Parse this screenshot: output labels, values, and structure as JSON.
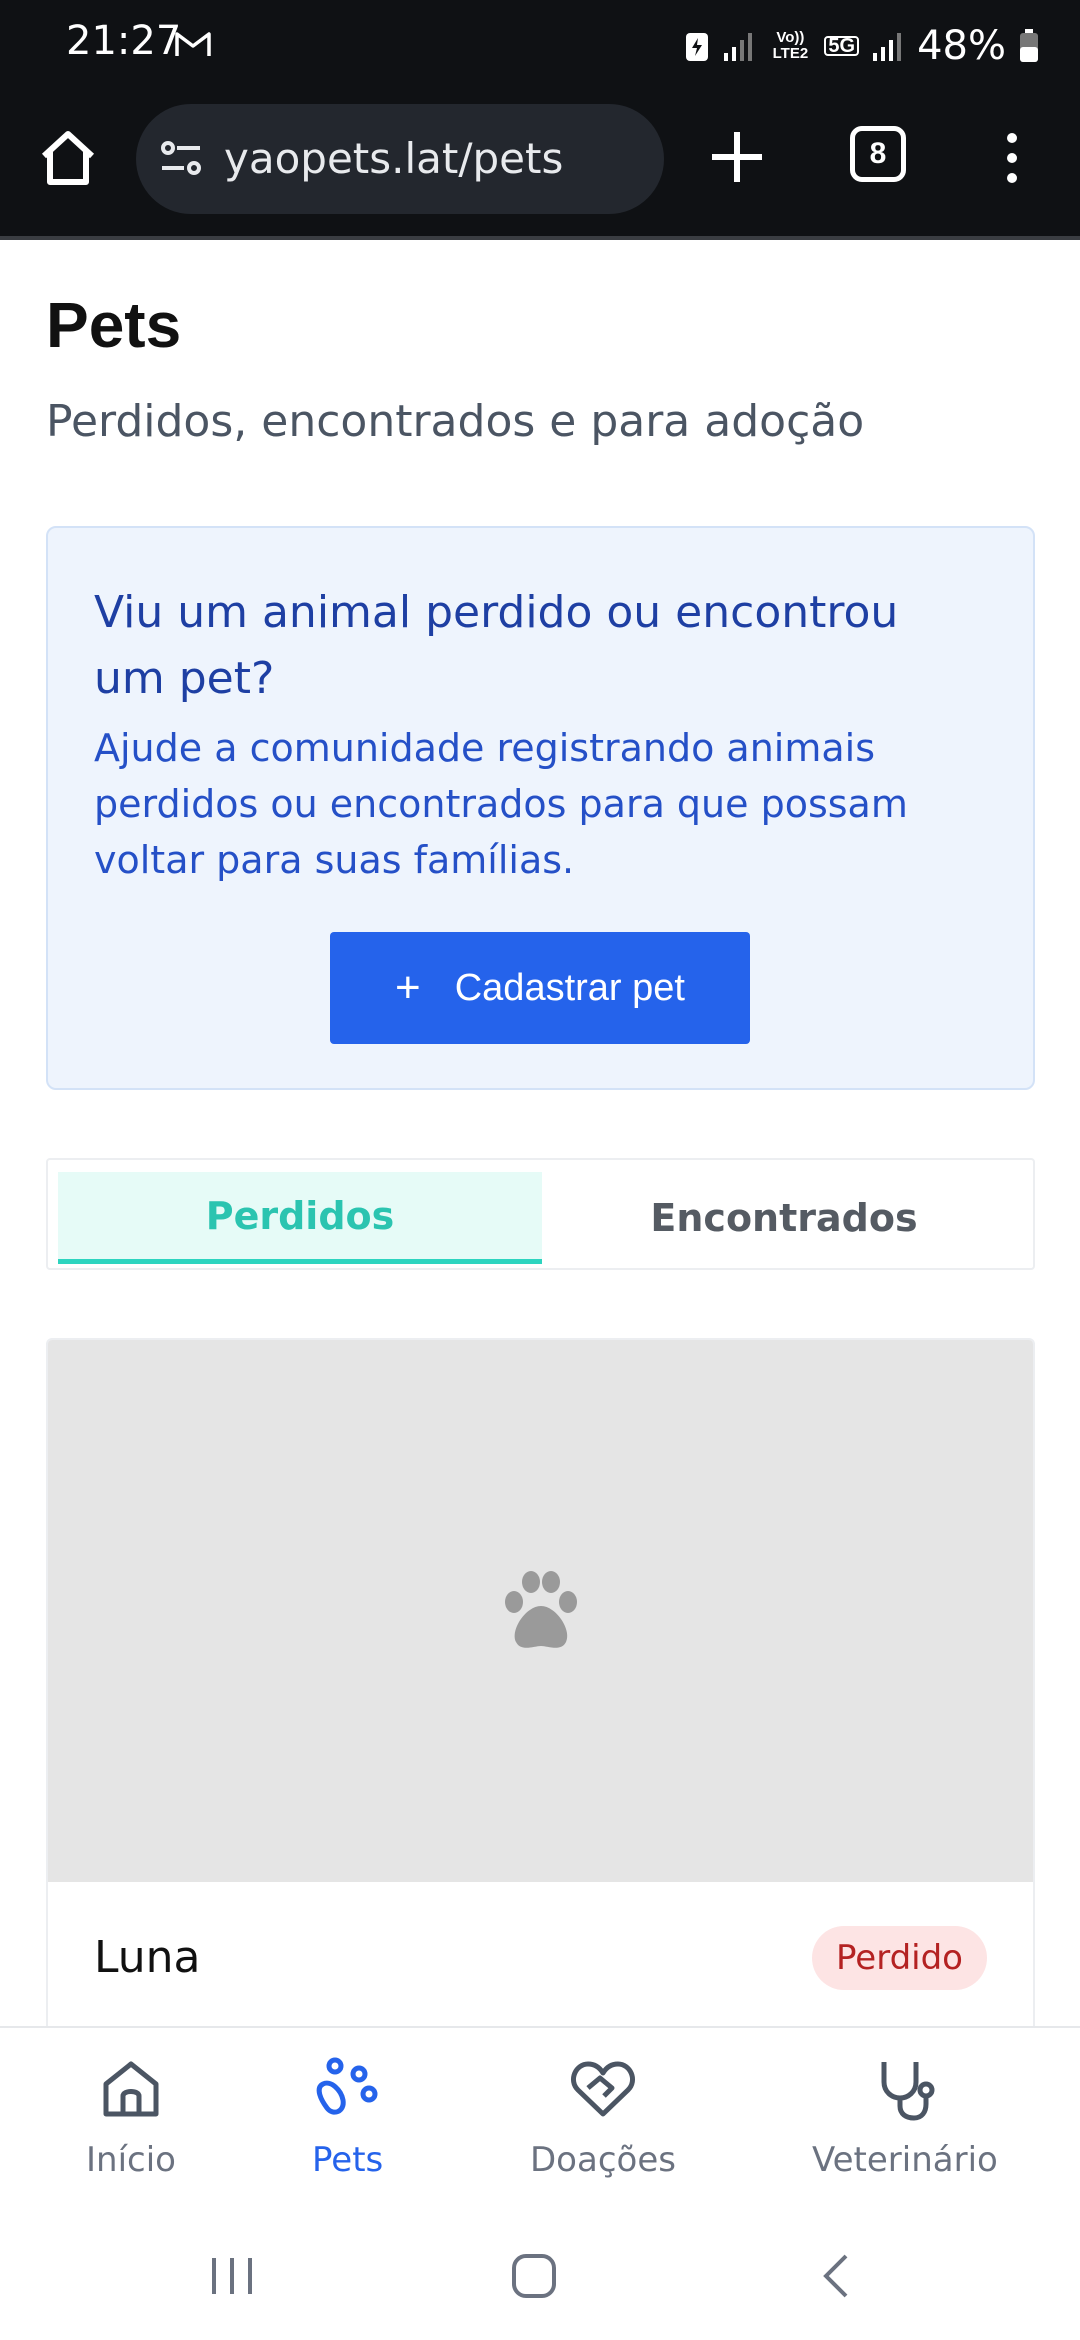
{
  "status_bar": {
    "time": "21:27",
    "battery": "48%",
    "network_volte": "Vo)) LTE2",
    "network_5g": "5G"
  },
  "browser": {
    "url": "yaopets.lat/pets",
    "tab_count": "8"
  },
  "page": {
    "title": "Pets",
    "subtitle": "Perdidos, encontrados e para adoção"
  },
  "info_card": {
    "title": "Viu um animal perdido ou encontrou um pet?",
    "body": "Ajude a comunidade registrando animais perdidos ou encontrados para que possam voltar para suas famílias.",
    "button_icon": "+",
    "button_label": "Cadastrar pet"
  },
  "tabs": [
    {
      "label": "Perdidos",
      "active": true
    },
    {
      "label": "Encontrados",
      "active": false
    }
  ],
  "pets": [
    {
      "name": "Luna",
      "status": "Perdido",
      "photo_icon": "paw-icon"
    }
  ],
  "bottom_nav": [
    {
      "label": "Início",
      "icon": "home-icon",
      "active": false
    },
    {
      "label": "Pets",
      "icon": "paw-icon",
      "active": true
    },
    {
      "label": "Doações",
      "icon": "heart-handshake-icon",
      "active": false
    },
    {
      "label": "Veterinário",
      "icon": "stethoscope-icon",
      "active": false
    }
  ],
  "colors": {
    "accent": "#2563eb",
    "teal": "#2dd4bf",
    "lost_badge_bg": "#fde4e4",
    "lost_badge_text": "#b42222"
  }
}
